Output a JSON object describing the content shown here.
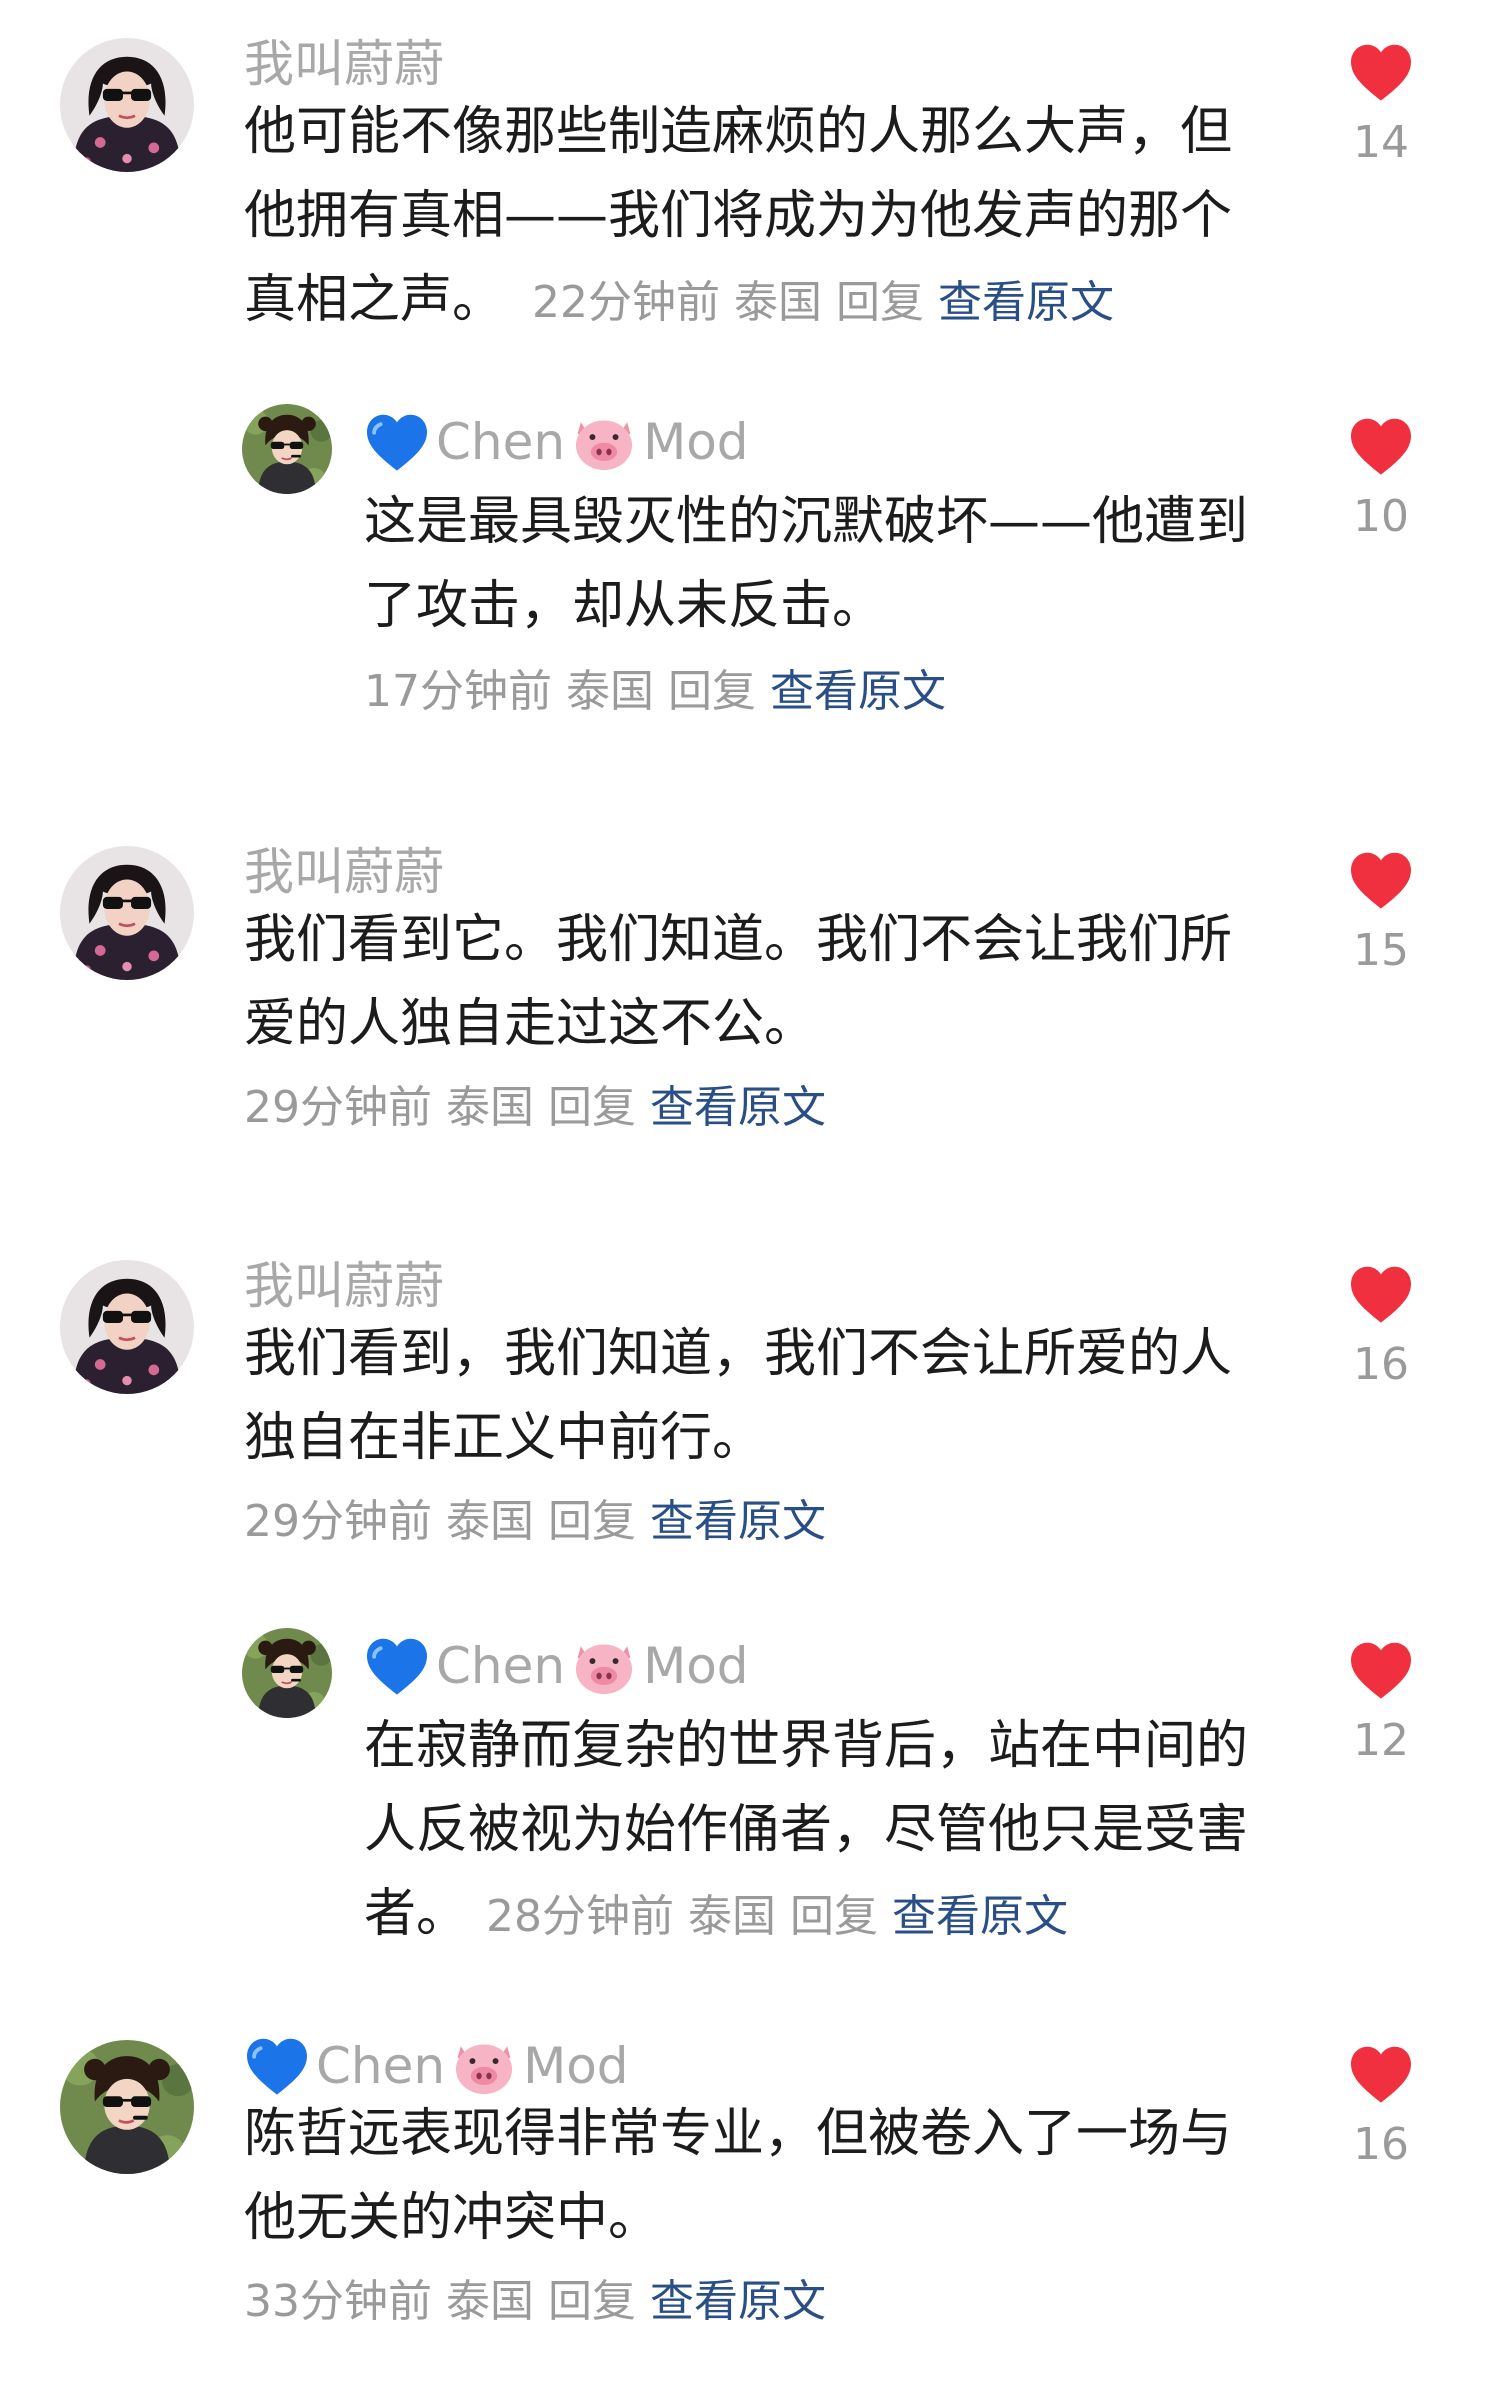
{
  "accent": {
    "heart": "#f0303e",
    "link": "#2a4f86",
    "muted": "#9a9a9a",
    "author": "#a8a8a8"
  },
  "comments": [
    {
      "author": "我叫蔚蔚",
      "lines": [
        "他可能不像那些制造麻烦的人那么大声，但",
        "他拥有真相——我们将成为为他发声的那个",
        "真相之声。"
      ],
      "time": "22分钟前",
      "location": "泰国",
      "reply": "回复",
      "view_original": "查看原文",
      "likes": "14"
    },
    {
      "author_name": "Chen",
      "author_suffix": "Mod",
      "lines": [
        "这是最具毁灭性的沉默破坏——他遭到",
        "了攻击，却从未反击。"
      ],
      "time": "17分钟前",
      "location": "泰国",
      "reply": "回复",
      "view_original": "查看原文",
      "likes": "10"
    },
    {
      "author": "我叫蔚蔚",
      "lines": [
        "我们看到它。我们知道。我们不会让我们所",
        "爱的人独自走过这不公。"
      ],
      "time": "29分钟前",
      "location": "泰国",
      "reply": "回复",
      "view_original": "查看原文",
      "likes": "15"
    },
    {
      "author": "我叫蔚蔚",
      "lines": [
        "我们看到，我们知道，我们不会让所爱的人",
        "独自在非正义中前行。"
      ],
      "time": "29分钟前",
      "location": "泰国",
      "reply": "回复",
      "view_original": "查看原文",
      "likes": "16"
    },
    {
      "author_name": "Chen",
      "author_suffix": "Mod",
      "lines": [
        "在寂静而复杂的世界背后，站在中间的",
        "人反被视为始作俑者，尽管他只是受害",
        "者。"
      ],
      "time": "28分钟前",
      "location": "泰国",
      "reply": "回复",
      "view_original": "查看原文",
      "likes": "12"
    },
    {
      "author_name": "Chen",
      "author_suffix": "Mod",
      "lines": [
        "陈哲远表现得非常专业，但被卷入了一场与",
        "他无关的冲突中。"
      ],
      "time": "33分钟前",
      "location": "泰国",
      "reply": "回复",
      "view_original": "查看原文",
      "likes": "16"
    }
  ]
}
